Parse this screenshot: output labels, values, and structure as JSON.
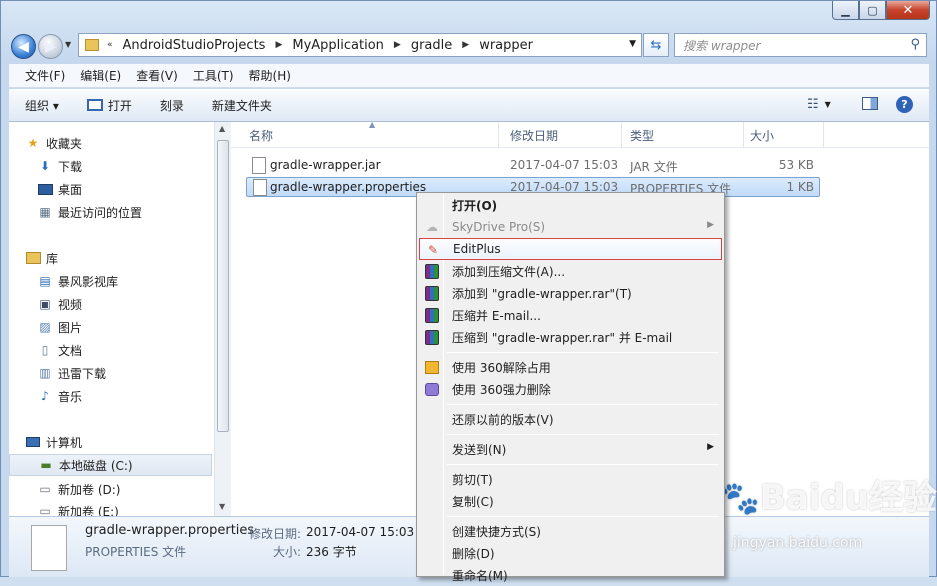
{
  "window": {
    "buttons": {
      "minimize": "▁",
      "maximize": "▢",
      "close": "✕"
    }
  },
  "nav": {
    "back_icon": "arrow-left-icon",
    "forward_icon": "arrow-right-icon",
    "breadcrumb_prefix": "«",
    "breadcrumb": [
      "AndroidStudioProjects",
      "MyApplication",
      "gradle",
      "wrapper"
    ],
    "search_placeholder": "搜索 wrapper"
  },
  "menubar": [
    "文件(F)",
    "编辑(E)",
    "查看(V)",
    "工具(T)",
    "帮助(H)"
  ],
  "toolbar": {
    "organize": "组织 ▾",
    "open": "打开",
    "burn": "刻录",
    "new_folder": "新建文件夹"
  },
  "sidebar": {
    "favorites": {
      "label": "收藏夹",
      "items": [
        "下载",
        "桌面",
        "最近访问的位置"
      ]
    },
    "libraries": {
      "label": "库",
      "items": [
        "暴风影视库",
        "视频",
        "图片",
        "文档",
        "迅雷下载",
        "音乐"
      ]
    },
    "computer": {
      "label": "计算机",
      "items": [
        "本地磁盘 (C:)",
        "新加卷 (D:)",
        "新加卷 (E:)"
      ]
    }
  },
  "columns": [
    "名称",
    "修改日期",
    "类型",
    "大小"
  ],
  "files": [
    {
      "name": "gradle-wrapper.jar",
      "date": "2017-04-07 15:03",
      "type": "JAR 文件",
      "size": "53 KB"
    },
    {
      "name": "gradle-wrapper.properties",
      "date": "2017-04-07 15:03",
      "type": "PROPERTIES 文件",
      "size": "1 KB"
    }
  ],
  "details": {
    "name": "gradle-wrapper.properties",
    "date_label": "修改日期:",
    "date": "2017-04-07 15:03",
    "type": "PROPERTIES 文件",
    "size_label": "大小:",
    "size": "236 字节"
  },
  "context_menu": {
    "open": "打开(O)",
    "skydrive": "SkyDrive Pro(S)",
    "editplus": "EditPlus",
    "add_archive": "添加到压缩文件(A)...",
    "add_rar": "添加到 \"gradle-wrapper.rar\"(T)",
    "compress_email": "压缩并 E-mail...",
    "compress_rar_email": "压缩到 \"gradle-wrapper.rar\" 并 E-mail",
    "unlock_360": "使用 360解除占用",
    "delete_360": "使用 360强力删除",
    "restore": "还原以前的版本(V)",
    "send_to": "发送到(N)",
    "cut": "剪切(T)",
    "copy": "复制(C)",
    "shortcut": "创建快捷方式(S)",
    "delete": "删除(D)",
    "rename": "重命名(M)"
  },
  "watermark": {
    "logo": "Baidu经验",
    "url": "jingyan.baidu.com"
  },
  "colors": {
    "highlight_border": "#d94343",
    "selection": "#c1dbfa"
  }
}
